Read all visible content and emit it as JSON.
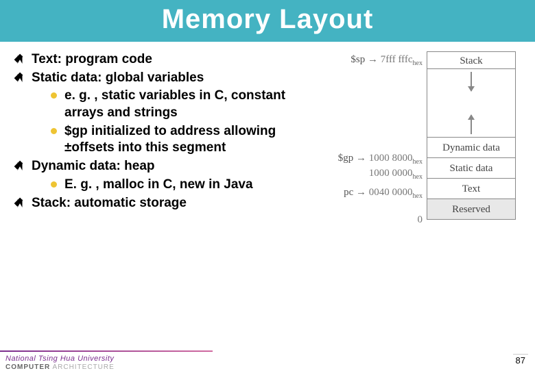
{
  "title": "Memory Layout",
  "bullets": [
    {
      "text": "Text: program code",
      "sub": []
    },
    {
      "text": "Static data: global variables",
      "sub": [
        "e. g. , static variables in C, constant arrays and strings",
        "$gp initialized to address allowing ±offsets into this segment"
      ]
    },
    {
      "text": "Dynamic data: heap",
      "sub": [
        "E. g. , malloc in C, new in Java"
      ]
    },
    {
      "text": "Stack: automatic storage",
      "sub": []
    }
  ],
  "diagram": {
    "regions": {
      "stack": "Stack",
      "dynamic": "Dynamic data",
      "static": "Static data",
      "text": "Text",
      "reserved": "Reserved"
    },
    "pointers": {
      "sp": {
        "reg": "$sp",
        "addr": "7fff fffc",
        "suffix": "hex"
      },
      "gp": {
        "reg": "$gp",
        "addr": "1000 8000",
        "suffix": "hex"
      },
      "pc": {
        "reg": "pc",
        "addr": "0040 0000",
        "suffix": "hex"
      },
      "static_base": {
        "addr": "1000 0000",
        "suffix": "hex"
      },
      "zero": {
        "addr": "0"
      }
    }
  },
  "footer": {
    "university": "National Tsing Hua University",
    "dept_prefix": "COMPUTER",
    "dept_suffix": " ARCHITECTURE",
    "page": "87"
  }
}
